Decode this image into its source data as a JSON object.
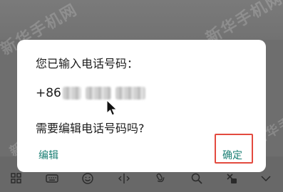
{
  "dialog": {
    "message_top": "您已输入电话号码：",
    "phone_prefix": "+86",
    "message_question": "需要编辑电话号码吗?",
    "edit_label": "编辑",
    "confirm_label": "确定"
  },
  "watermark": {
    "text": "新华手机网"
  },
  "icons": {
    "grid": "grid-icon",
    "keyboard": "keyboard-icon",
    "emoji": "emoji-icon",
    "cursor_move": "cursor-move-icon",
    "voice": "voice-icon",
    "search": "search-icon",
    "clipboard": "clipboard-icon",
    "collapse": "collapse-keyboard-icon"
  },
  "colors": {
    "dialog_bg": "#ffffff",
    "button_text": "#1b7f74",
    "highlight_frame": "#e34a3f",
    "overlay": "#6e6e6e"
  }
}
